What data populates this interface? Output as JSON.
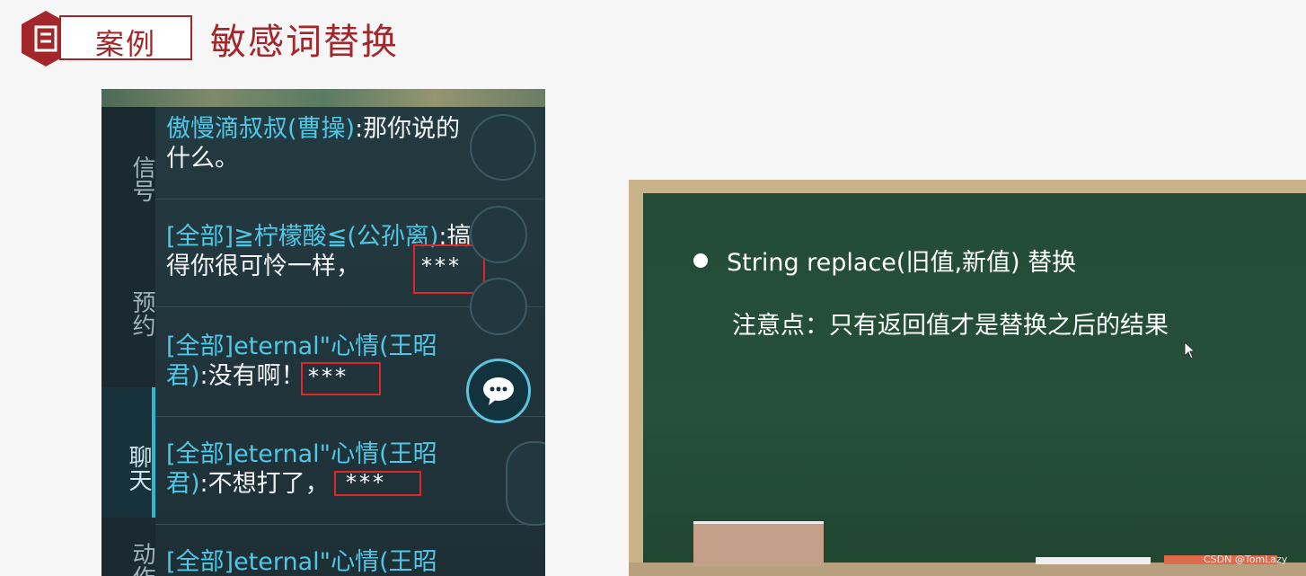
{
  "header": {
    "badge_label": "案例",
    "title": "敏感词替换"
  },
  "game_chat": {
    "side_tabs": [
      {
        "label": "信号"
      },
      {
        "label": "预约"
      },
      {
        "label": "聊天"
      },
      {
        "label": "动作"
      }
    ],
    "messages": [
      {
        "name": "傲慢滴叔叔(曹操)",
        "text": ":那你说的什么。"
      },
      {
        "name": "[全部]≧柠檬酸≦(公孙离)",
        "text": ":搞得你很可怜一样，",
        "censored": "***"
      },
      {
        "name": "[全部]eternal\"心情(王昭君)",
        "text": ":没有啊！",
        "censored": "***"
      },
      {
        "name": "[全部]eternal\"心情(王昭君)",
        "text": ":不想打了，",
        "censored": "***"
      },
      {
        "name": "[全部]eternal\"心情(王昭",
        "text": ""
      }
    ]
  },
  "board": {
    "point1": "String replace(旧值,新值)  替换",
    "point2": "注意点：只有返回值才是替换之后的结果"
  },
  "watermark": "CSDN @TomLazy",
  "colors": {
    "accent": "#a3262a",
    "chat_name": "#4fc7e6",
    "highlight_box": "#e02626",
    "board_green": "#244c38"
  }
}
